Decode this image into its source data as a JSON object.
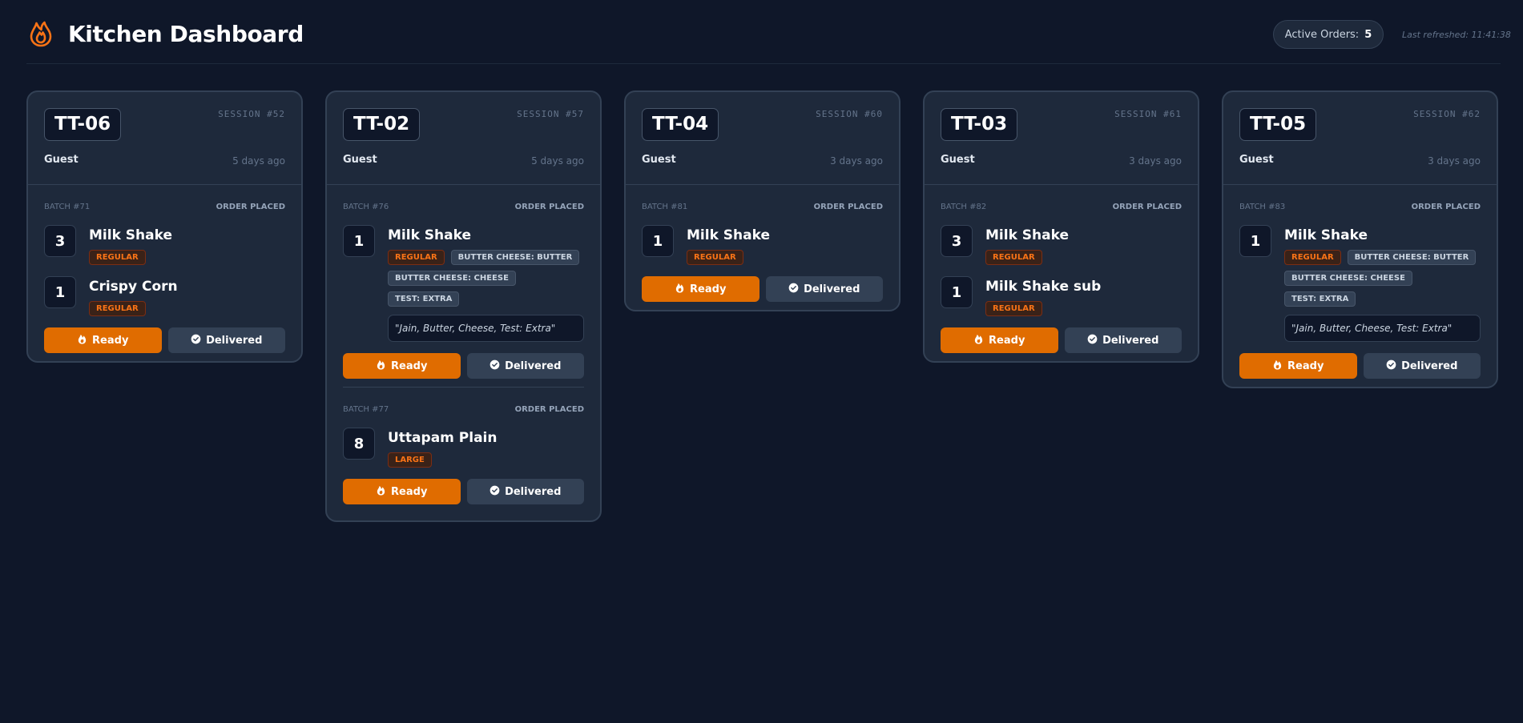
{
  "header": {
    "title": "Kitchen Dashboard",
    "active_label": "Active Orders:",
    "active_count": "5",
    "last_refreshed": "Last refreshed: 11:41:38"
  },
  "colors": {
    "accent": "#e06c00",
    "background": "#0f1729",
    "card": "#1e293b"
  },
  "icons": {
    "logo": "flame-icon",
    "ready": "flame-icon",
    "delivered": "check-circle-icon"
  },
  "labels": {
    "ready": "Ready",
    "delivered": "Delivered"
  },
  "cards": [
    {
      "table": "TT-06",
      "session": "SESSION #52",
      "guest": "Guest",
      "ago": "5 days ago",
      "batches": [
        {
          "id": "BATCH #71",
          "status": "ORDER PLACED",
          "items": [
            {
              "qty": "3",
              "name": "Milk Shake",
              "size": "REGULAR",
              "options": [],
              "note": ""
            },
            {
              "qty": "1",
              "name": "Crispy Corn",
              "size": "REGULAR",
              "options": [],
              "note": ""
            }
          ]
        }
      ]
    },
    {
      "table": "TT-02",
      "session": "SESSION #57",
      "guest": "Guest",
      "ago": "5 days ago",
      "batches": [
        {
          "id": "BATCH #76",
          "status": "ORDER PLACED",
          "items": [
            {
              "qty": "1",
              "name": "Milk Shake",
              "size": "REGULAR",
              "options": [
                "BUTTER CHEESE: BUTTER",
                "BUTTER CHEESE: CHEESE",
                "TEST: EXTRA"
              ],
              "note": "\"Jain, Butter, Cheese, Test: Extra\""
            }
          ]
        },
        {
          "id": "BATCH #77",
          "status": "ORDER PLACED",
          "items": [
            {
              "qty": "8",
              "name": "Uttapam Plain",
              "size": "LARGE",
              "options": [],
              "note": ""
            }
          ]
        }
      ]
    },
    {
      "table": "TT-04",
      "session": "SESSION #60",
      "guest": "Guest",
      "ago": "3 days ago",
      "batches": [
        {
          "id": "BATCH #81",
          "status": "ORDER PLACED",
          "items": [
            {
              "qty": "1",
              "name": "Milk Shake",
              "size": "REGULAR",
              "options": [],
              "note": ""
            }
          ]
        }
      ]
    },
    {
      "table": "TT-03",
      "session": "SESSION #61",
      "guest": "Guest",
      "ago": "3 days ago",
      "batches": [
        {
          "id": "BATCH #82",
          "status": "ORDER PLACED",
          "items": [
            {
              "qty": "3",
              "name": "Milk Shake",
              "size": "REGULAR",
              "options": [],
              "note": ""
            },
            {
              "qty": "1",
              "name": "Milk Shake sub",
              "size": "REGULAR",
              "options": [],
              "note": ""
            }
          ]
        }
      ]
    },
    {
      "table": "TT-05",
      "session": "SESSION #62",
      "guest": "Guest",
      "ago": "3 days ago",
      "batches": [
        {
          "id": "BATCH #83",
          "status": "ORDER PLACED",
          "items": [
            {
              "qty": "1",
              "name": "Milk Shake",
              "size": "REGULAR",
              "options": [
                "BUTTER CHEESE: BUTTER",
                "BUTTER CHEESE: CHEESE",
                "TEST: EXTRA"
              ],
              "note": "\"Jain, Butter, Cheese, Test: Extra\""
            }
          ]
        }
      ]
    }
  ]
}
